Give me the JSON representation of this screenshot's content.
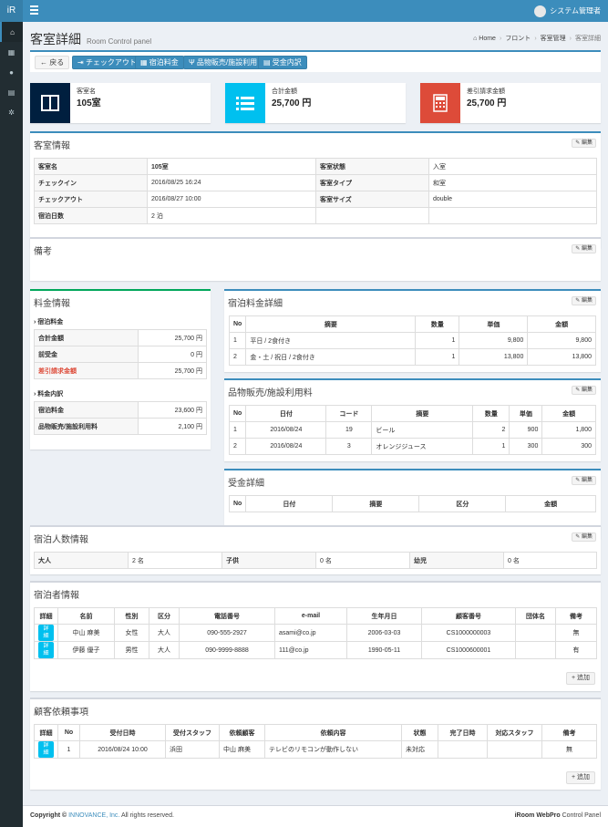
{
  "app": {
    "logo": "iR",
    "user_name": "システム管理者"
  },
  "page": {
    "title": "客室詳細",
    "subtitle": "Room Control panel"
  },
  "breadcrumb": [
    "Home",
    "フロント",
    "客室管理",
    "客室詳細"
  ],
  "toolbar": {
    "back": "戻る",
    "checkout": "チェックアウト",
    "fee": "宿泊料金",
    "goods": "品物販売/施設利用",
    "payment": "受金内訳"
  },
  "info": [
    {
      "label": "客室名",
      "value": "105室",
      "color": "#001f3f"
    },
    {
      "label": "合計金額",
      "value": "25,700 円",
      "color": "#00c0ef"
    },
    {
      "label": "差引請求金額",
      "value": "25,700 円",
      "color": "#dd4b39"
    }
  ],
  "edit_label": "編集",
  "room": {
    "title": "客室情報",
    "rows": [
      [
        "客室名",
        "105室",
        "客室状態",
        "入室"
      ],
      [
        "チェックイン",
        "2016/08/25 16:24",
        "客室タイプ",
        "和室"
      ],
      [
        "チェックアウト",
        "2016/08/27 10:00",
        "客室サイズ",
        "double"
      ],
      [
        "宿泊日数",
        "2 泊",
        "",
        ""
      ]
    ]
  },
  "remarks": {
    "title": "備考"
  },
  "fees": {
    "title": "料金情報",
    "sec1": "宿泊料金",
    "rows1": [
      [
        "合計金額",
        "25,700 円"
      ],
      [
        "前受金",
        "0 円"
      ],
      [
        "差引請求金額",
        "25,700 円"
      ]
    ],
    "sec2": "料金内訳",
    "rows2": [
      [
        "宿泊料金",
        "23,600 円"
      ],
      [
        "品物販売/施設利用料",
        "2,100 円"
      ]
    ]
  },
  "stay_fee": {
    "title": "宿泊料金詳細",
    "headers": [
      "No",
      "摘要",
      "数量",
      "単価",
      "金額"
    ],
    "rows": [
      [
        "1",
        "平日 / 2食付き",
        "1",
        "9,800",
        "9,800"
      ],
      [
        "2",
        "金・土 / 祝日 / 2食付き",
        "1",
        "13,800",
        "13,800"
      ]
    ]
  },
  "goods": {
    "title": "品物販売/施設利用料",
    "headers": [
      "No",
      "日付",
      "コード",
      "摘要",
      "数量",
      "単価",
      "金額"
    ],
    "rows": [
      [
        "1",
        "2016/08/24",
        "19",
        "ビール",
        "2",
        "900",
        "1,800"
      ],
      [
        "2",
        "2016/08/24",
        "3",
        "オレンジジュース",
        "1",
        "300",
        "300"
      ]
    ]
  },
  "payment": {
    "title": "受金詳細",
    "headers": [
      "No",
      "日付",
      "摘要",
      "区分",
      "金額"
    ]
  },
  "guests_count": {
    "title": "宿泊人数情報",
    "cells": [
      "大人",
      "2 名",
      "子供",
      "0 名",
      "幼児",
      "0 名"
    ]
  },
  "guests": {
    "title": "宿泊者情報",
    "headers": [
      "詳細",
      "名前",
      "性別",
      "区分",
      "電話番号",
      "e-mail",
      "生年月日",
      "顧客番号",
      "団体名",
      "備考"
    ],
    "rows": [
      [
        "詳細",
        "中山 麻美",
        "女性",
        "大人",
        "090-555-2927",
        "asami@co.jp",
        "2006-03-03",
        "CS1000000003",
        "",
        "無"
      ],
      [
        "詳細",
        "伊藤 優子",
        "男性",
        "大人",
        "090-9999-8888",
        "111@co.jp",
        "1990-05-11",
        "CS1000600001",
        "",
        "有"
      ]
    ],
    "add": "追加"
  },
  "requests": {
    "title": "顧客依頼事項",
    "headers": [
      "詳細",
      "No",
      "受付日時",
      "受付スタッフ",
      "依頼顧客",
      "依頼内容",
      "状態",
      "完了日時",
      "対応スタッフ",
      "備考"
    ],
    "rows": [
      [
        "詳細",
        "1",
        "2016/08/24 10:00",
        "浜田",
        "中山 麻美",
        "テレビのリモコンが動作しない",
        "未対応",
        "",
        "",
        "無"
      ]
    ],
    "add": "追加"
  },
  "footer": {
    "copy": "Copyright © ",
    "company": "INNOVANCE, Inc.",
    "rights": " All rights reserved.",
    "product_bold": "iRoom WebPro",
    "product": " Control Panel"
  }
}
